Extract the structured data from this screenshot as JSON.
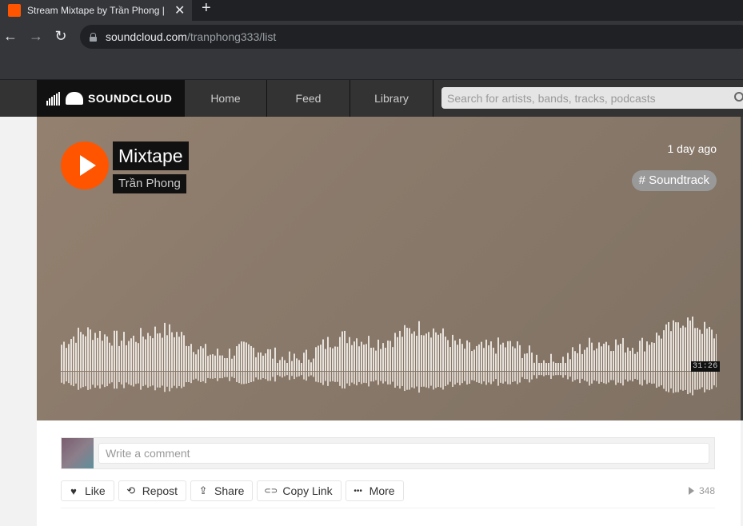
{
  "browser": {
    "tab_title": "Stream Mixtape by Trần Phong | S",
    "url_host": "soundcloud.com",
    "url_path": "/tranphong333/list"
  },
  "header": {
    "logo_text": "SOUNDCLOUD",
    "nav": [
      {
        "label": "Home"
      },
      {
        "label": "Feed"
      },
      {
        "label": "Library"
      }
    ],
    "search_placeholder": "Search for artists, bands, tracks, podcasts"
  },
  "track": {
    "title": "Mixtape",
    "artist": "Trần Phong",
    "posted": "1 day ago",
    "tag": "# Soundtrack",
    "duration": "31:26",
    "accent_color": "#ff5500"
  },
  "comment": {
    "placeholder": "Write a comment"
  },
  "actions": [
    {
      "icon": "heart-icon",
      "glyph": "♥",
      "label": "Like"
    },
    {
      "icon": "repost-icon",
      "glyph": "⟲",
      "label": "Repost"
    },
    {
      "icon": "share-icon",
      "glyph": "⇪",
      "label": "Share"
    },
    {
      "icon": "link-icon",
      "glyph": "⊂⊃",
      "label": "Copy Link"
    },
    {
      "icon": "more-icon",
      "glyph": "•••",
      "label": "More"
    }
  ],
  "stats": {
    "plays": "348"
  }
}
